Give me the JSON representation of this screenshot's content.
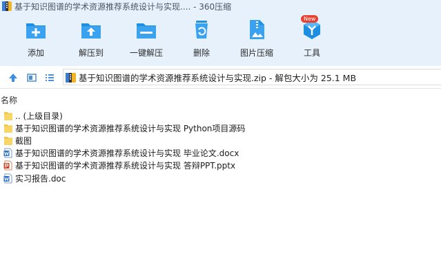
{
  "window": {
    "title": "基于知识图谱的学术资源推荐系统设计与实现.... - 360压缩"
  },
  "toolbar": {
    "items": [
      {
        "label": "添加",
        "icon": "add-icon"
      },
      {
        "label": "解压到",
        "icon": "extract-to-icon"
      },
      {
        "label": "一键解压",
        "icon": "one-click-extract-icon"
      },
      {
        "label": "删除",
        "icon": "delete-icon"
      },
      {
        "label": "图片压缩",
        "icon": "image-compress-icon"
      },
      {
        "label": "工具",
        "icon": "tools-icon",
        "badge": "New"
      }
    ]
  },
  "address_bar": {
    "path": "基于知识图谱的学术资源推荐系统设计与实现.zip - 解包大小为 25.1 MB"
  },
  "file_list": {
    "column_name": "名称",
    "items": [
      {
        "name": ".. (上级目录)",
        "type": "folder"
      },
      {
        "name": "基于知识图谱的学术资源推荐系统设计与实现 Python项目源码",
        "type": "folder"
      },
      {
        "name": "截图",
        "type": "folder"
      },
      {
        "name": "基于知识图谱的学术资源推荐系统设计与实现 毕业论文.docx",
        "type": "word"
      },
      {
        "name": "基于知识图谱的学术资源推荐系统设计与实现 答辩PPT.pptx",
        "type": "powerpoint"
      },
      {
        "name": "实习报告.doc",
        "type": "word"
      }
    ]
  },
  "colors": {
    "toolbar_bg": "#e6f1fb",
    "icon_blue": "#1e8fe0",
    "folder_yellow": "#f5c342",
    "word_blue": "#2b6cc4",
    "ppt_red": "#d04a2a",
    "badge_red": "#e8402f"
  }
}
